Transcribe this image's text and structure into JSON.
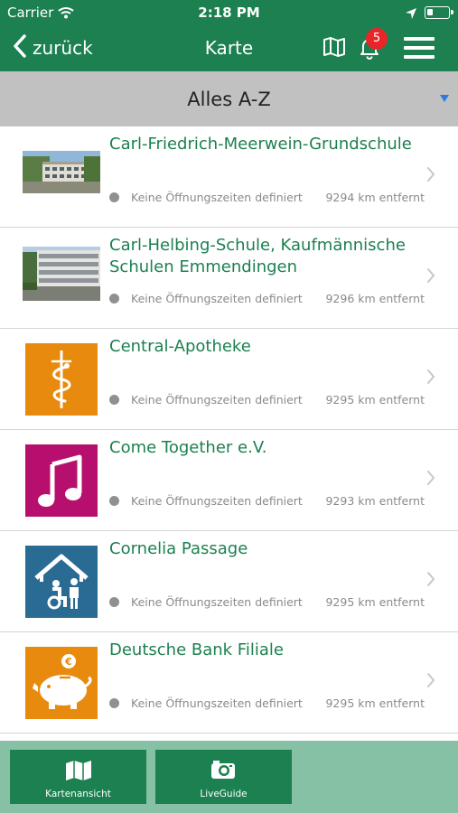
{
  "status_bar": {
    "carrier": "Carrier",
    "time": "2:18 PM"
  },
  "nav": {
    "back_label": "zurück",
    "title": "Karte",
    "notification_count": "5"
  },
  "filter": {
    "label": "Alles A-Z"
  },
  "items": [
    {
      "name": "Carl-Friedrich-Meerwein-Grundschule",
      "hours": "Keine Öffnungszeiten definiert",
      "distance": "9294 km entfernt",
      "icon": "school-photo"
    },
    {
      "name": "Carl-Helbing-Schule, Kaufmännische Schulen Emmendingen",
      "hours": "Keine Öffnungszeiten definiert",
      "distance": "9296 km entfernt",
      "icon": "school-building-photo"
    },
    {
      "name": "Central-Apotheke",
      "hours": "Keine Öffnungszeiten definiert",
      "distance": "9295 km entfernt",
      "icon": "pharmacy-icon",
      "icon_color": "#e88a0e"
    },
    {
      "name": "Come Together e.V.",
      "hours": "Keine Öffnungszeiten definiert",
      "distance": "9293 km entfernt",
      "icon": "music-note-icon",
      "icon_color": "#b70f6e"
    },
    {
      "name": "Cornelia Passage",
      "hours": "Keine Öffnungszeiten definiert",
      "distance": "9295 km entfernt",
      "icon": "care-home-icon",
      "icon_color": "#2a6b94"
    },
    {
      "name": "Deutsche Bank Filiale",
      "hours": "Keine Öffnungszeiten definiert",
      "distance": "9295 km entfernt",
      "icon": "piggy-bank-icon",
      "icon_color": "#e88a0e"
    }
  ],
  "tabs": [
    {
      "label": "Kartenansicht",
      "icon": "map-icon"
    },
    {
      "label": "LiveGuide",
      "icon": "camera-icon"
    }
  ],
  "colors": {
    "brand_green": "#1c8050",
    "badge_red": "#e8262a",
    "tabbar_bg": "#86c1a6"
  }
}
